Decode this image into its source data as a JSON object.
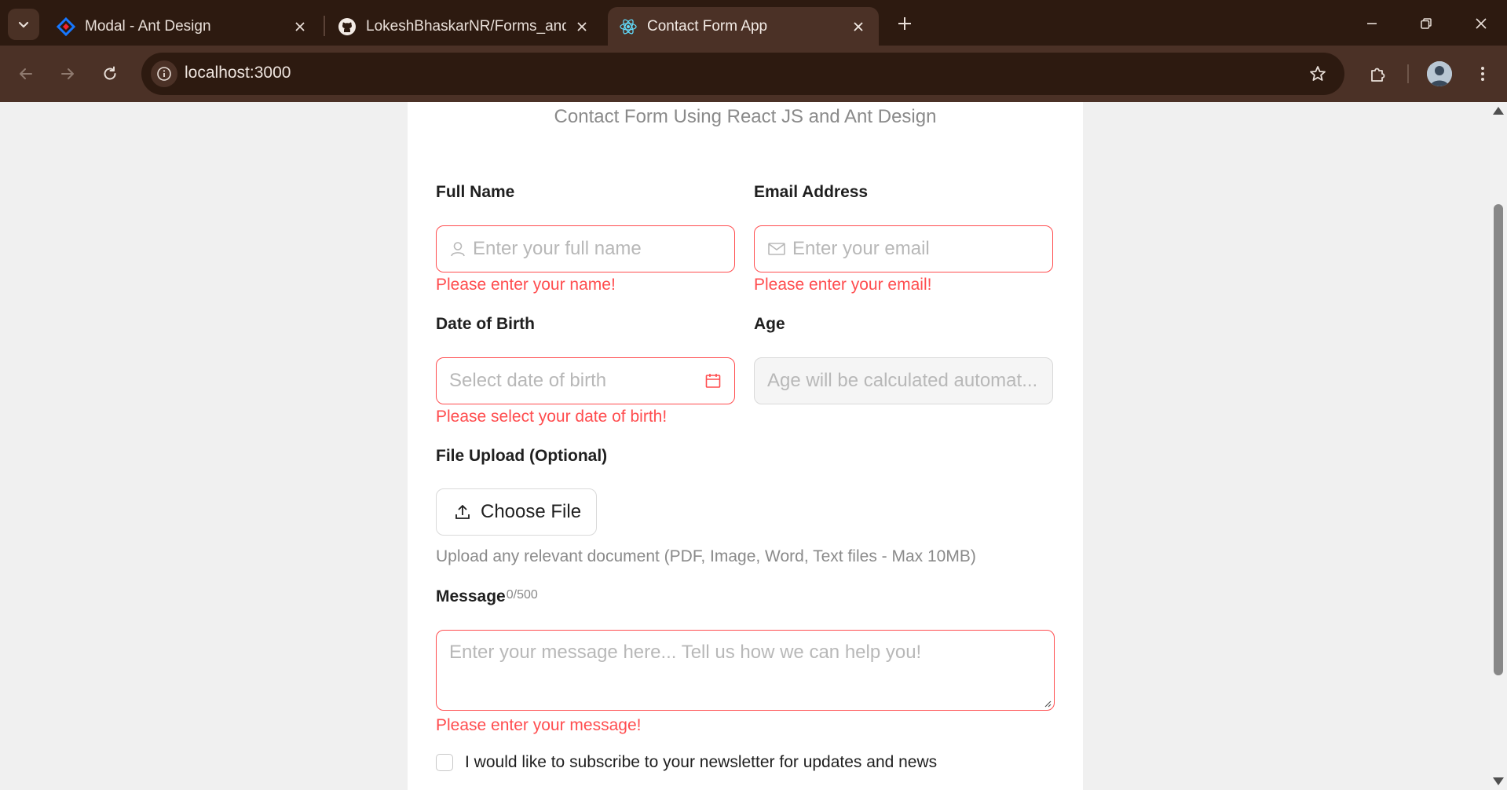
{
  "browser": {
    "tabs": [
      {
        "title": "Modal - Ant Design",
        "icon": "ant-design-logo-icon",
        "active": false
      },
      {
        "title": "LokeshBhaskarNR/Forms_and_U",
        "icon": "github-icon",
        "active": false
      },
      {
        "title": "Contact Form App",
        "icon": "react-logo-icon",
        "active": true
      }
    ],
    "url": "localhost:3000"
  },
  "form": {
    "subtitle": "Contact Form Using React JS and Ant Design",
    "full_name": {
      "label": "Full Name",
      "placeholder": "Enter your full name",
      "error": "Please enter your name!"
    },
    "email": {
      "label": "Email Address",
      "placeholder": "Enter your email",
      "error": "Please enter your email!"
    },
    "dob": {
      "label": "Date of Birth",
      "placeholder": "Select date of birth",
      "error": "Please select your date of birth!"
    },
    "age": {
      "label": "Age",
      "placeholder": "Age will be calculated automat..."
    },
    "upload": {
      "label": "File Upload (Optional)",
      "button": "Choose File",
      "hint": "Upload any relevant document (PDF, Image, Word, Text files - Max 10MB)"
    },
    "message": {
      "label": "Message",
      "counter": "0/500",
      "placeholder": "Enter your message here... Tell us how we can help you!",
      "error": "Please enter your message!"
    },
    "newsletter": {
      "label": "I would like to subscribe to your newsletter for updates and news",
      "checked": false
    }
  },
  "colors": {
    "error": "#ff4d4f",
    "chrome_dark": "#2d1a10",
    "chrome_mid": "#4b3126"
  }
}
